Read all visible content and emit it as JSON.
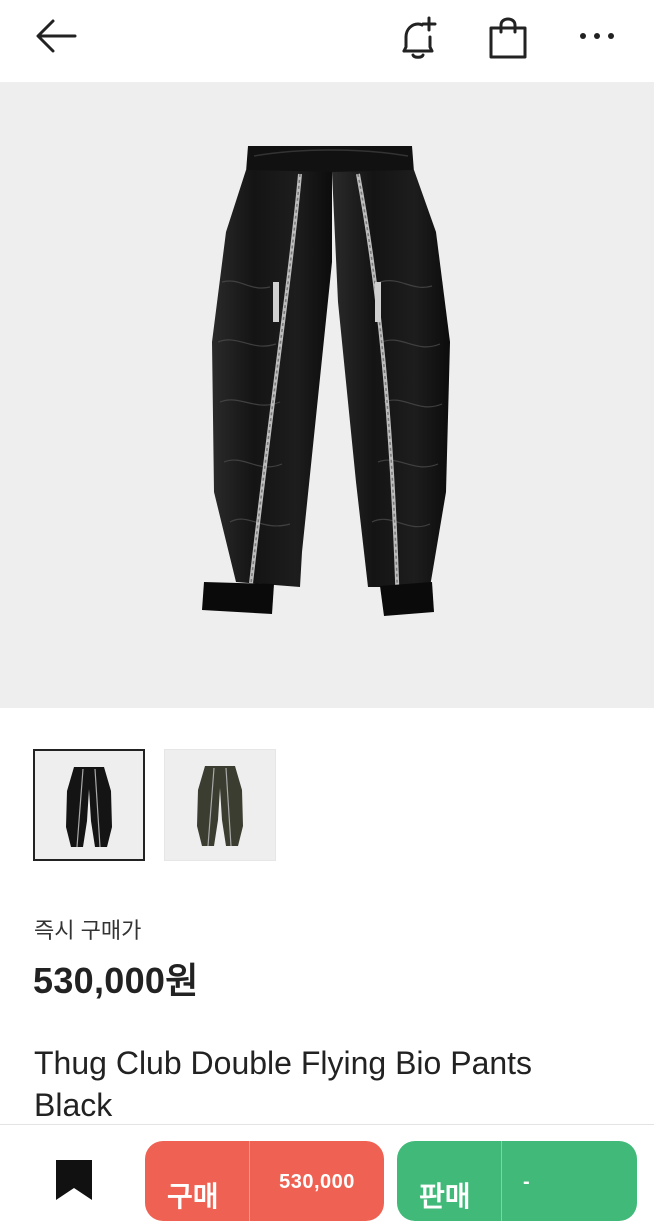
{
  "nav": {
    "back_icon": "arrow-left-icon",
    "alert_icon": "bell-plus-icon",
    "bag_icon": "shopping-bag-icon",
    "more_icon": "more-horizontal-icon"
  },
  "product": {
    "image_icon": "pants-photo",
    "thumbnails": [
      {
        "variant": "black",
        "selected": true
      },
      {
        "variant": "olive",
        "selected": false
      }
    ],
    "buy_now_label": "즉시 구매가",
    "price": "530,000원",
    "title": "Thug Club Double Flying Bio Pants Black"
  },
  "bottom": {
    "wishlist_icon": "bookmark-icon",
    "buy_label": "구매",
    "buy_price": "530,000",
    "sell_label": "판매",
    "sell_price": "-"
  },
  "colors": {
    "buy": "#ef6253",
    "sell": "#41b979",
    "image_bg": "#eeeeee"
  }
}
